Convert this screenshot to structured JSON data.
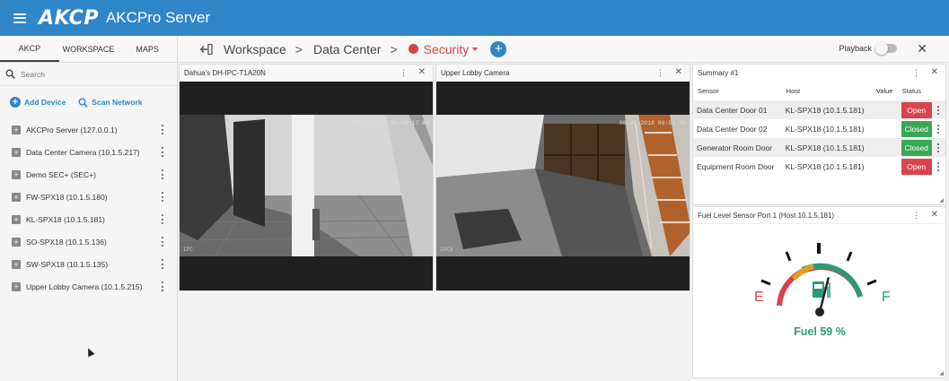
{
  "app": {
    "logo": "AKCP",
    "title": "AKCPro Server"
  },
  "sidebar": {
    "tabs": [
      {
        "label": "AKCP"
      },
      {
        "label": "WORKSPACE"
      },
      {
        "label": "MAPS"
      }
    ],
    "search_placeholder": "Search",
    "add_device": "Add Device",
    "scan_network": "Scan Network",
    "devices": [
      {
        "label": "AKCPro Server (127.0.0.1)"
      },
      {
        "label": "Data Center Camera (10.1.5.217)"
      },
      {
        "label": "Demo SEC+ (SEC+)"
      },
      {
        "label": "FW-SPX18 (10.1.5.180)"
      },
      {
        "label": "KL-SPX18 (10.1.5.181)"
      },
      {
        "label": "SO-SPX18 (10.1.5.136)"
      },
      {
        "label": "SW-SPX18 (10.1.5.135)"
      },
      {
        "label": "Upper Lobby Camera (10.1.5.215)"
      }
    ]
  },
  "toolbar": {
    "crumbs": [
      "Workspace",
      "Data Center",
      "Security"
    ],
    "playback": "Playback"
  },
  "cameras": [
    {
      "title": "Dahua's DH-IPC-T1A20N",
      "timestamp": "08-01-2018 09:50:17 AM",
      "tag": "IPC"
    },
    {
      "title": "Upper Lobby Camera",
      "timestamp": "08-01-2018 09:51:30",
      "tag": "IPC3"
    }
  ],
  "summary": {
    "title": "Summary #1",
    "columns": [
      "Sensor",
      "Host",
      "Value",
      "Status"
    ],
    "rows": [
      {
        "sensor": "Data Center Door 01",
        "host": "KL-SPX18 (10.1.5.181)",
        "value": "",
        "status": "Open"
      },
      {
        "sensor": "Data Center Door 02",
        "host": "KL-SPX18 (10.1.5.181)",
        "value": "",
        "status": "Closed"
      },
      {
        "sensor": "Generator Room Door",
        "host": "KL-SPX18 (10.1.5.181)",
        "value": "",
        "status": "Closed"
      },
      {
        "sensor": "Equipment Room Door",
        "host": "KL-SPX18 (10.1.5.181)",
        "value": "",
        "status": "Open"
      }
    ]
  },
  "fuel": {
    "title": "Fuel Level Sensor Port 1 (Host 10.1.5.181)",
    "empty_label": "E",
    "full_label": "F",
    "readout": "Fuel 59 %",
    "level_percent": 59
  },
  "colors": {
    "header": "#2f86c9",
    "accent": "#2f86c9",
    "open": "#d9434b",
    "closed": "#3aa757",
    "security": "#d9434b"
  }
}
